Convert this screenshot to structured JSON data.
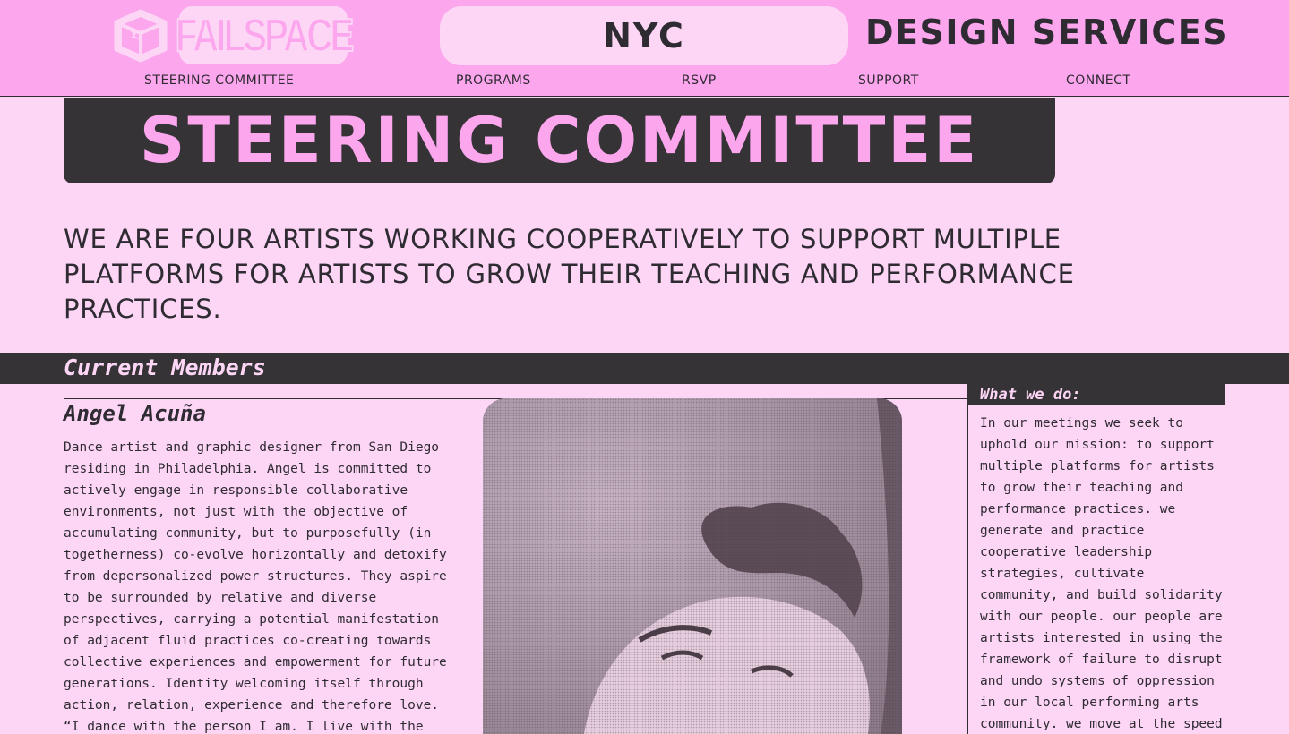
{
  "header": {
    "logo_text": "FAILSPACE",
    "city": "NYC",
    "design_services": "DESIGN SERVICES",
    "nav": [
      "STEERING COMMITTEE",
      "PROGRAMS",
      "RSVP",
      "SUPPORT",
      "CONNECT"
    ]
  },
  "page": {
    "title": "STEERING COMMITTEE",
    "intro": "WE ARE FOUR ARTISTS WORKING COOPERATIVELY TO SUPPORT MULTIPLE PLATFORMS FOR ARTISTS TO GROW THEIR TEACHING AND PERFORMANCE PRACTICES."
  },
  "members": {
    "section_title": "Current Members",
    "items": [
      {
        "name": "Angel Acuña",
        "bio": "Dance artist and graphic designer from San Diego\nresiding in Philadelphia. Angel is committed to\nactively engage in responsible collaborative\nenvironments, not just with the objective of\naccumulating community, but to purposefully (in\ntogetherness) co-evolve horizontally and detoxify\nfrom depersonalized power structures.  They aspire\nto be surrounded by relative and diverse\nperspectives, carrying a potential manifestation\nof adjacent fluid practices co-creating towards\ncollective experiences and empowerment for future\ngenerations. Identity welcoming itself through\naction, relation, experience and therefore love.\n“I dance with the person I am. I live with the"
      }
    ]
  },
  "sidebar": {
    "heading": "What we do:",
    "text": "In our meetings we seek to\nuphold our mission: to support\nmultiple platforms for artists\nto grow their teaching and\nperformance practices. we\ngenerate and practice\ncooperative leadership\nstrategies, cultivate\ncommunity, and build solidarity\nwith our people. our people are\nartists interested in using the\nframework of failure to disrupt\nand undo systems of oppression\nin our local performing arts\ncommunity. we move at the speed"
  },
  "colors": {
    "pink_header": "#fca6ee",
    "pink_bg": "#fdd6f6",
    "dark": "#353336"
  }
}
